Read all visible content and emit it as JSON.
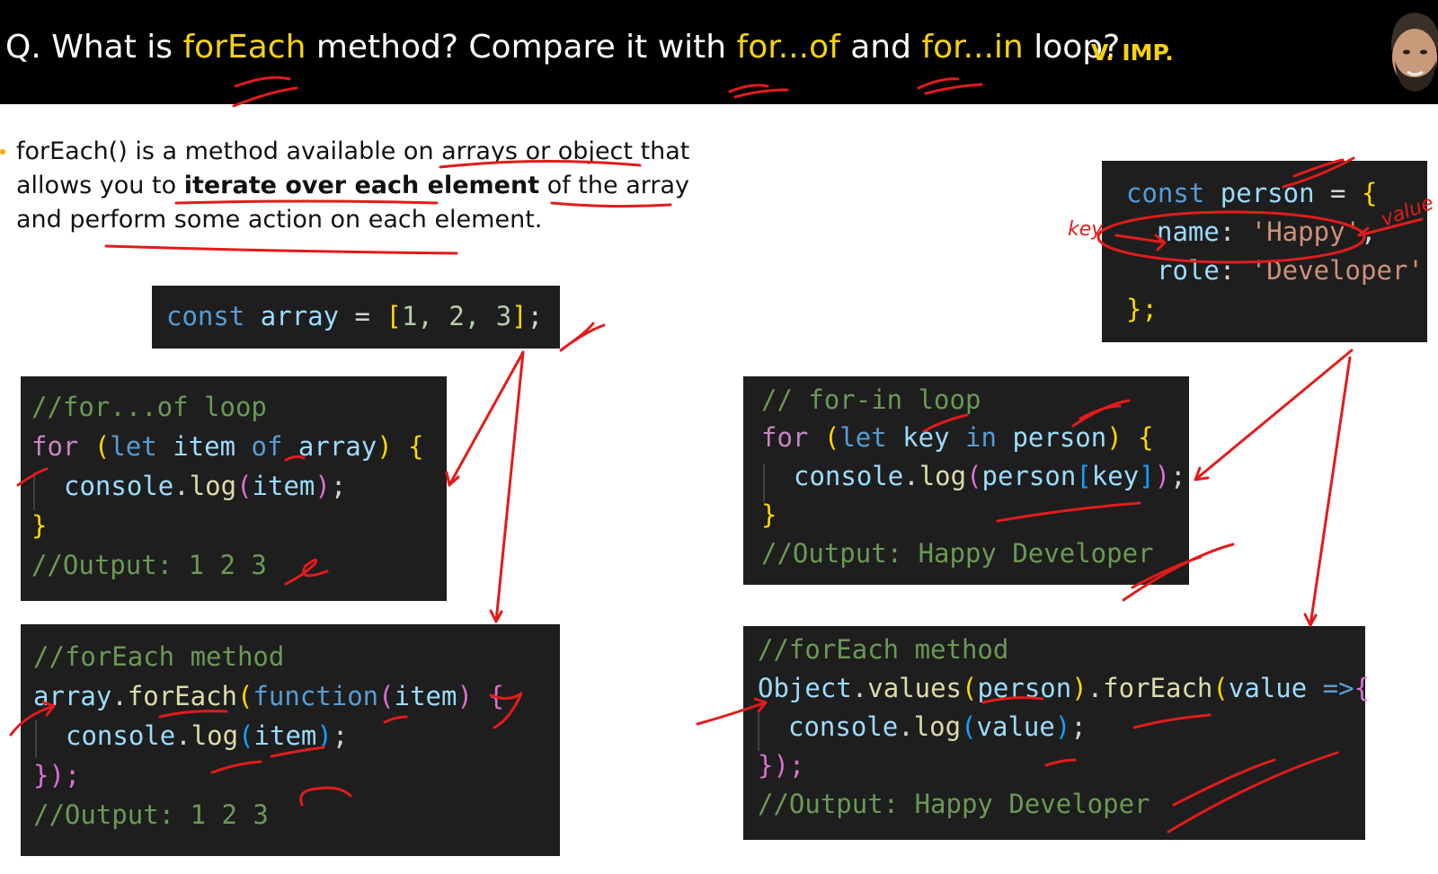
{
  "header": {
    "question_prefix": "Q. What is ",
    "kw_foreach": "forEach",
    "question_mid1": " method? Compare it with ",
    "kw_forof": "for...of",
    "question_mid2": " and ",
    "kw_forin": "for...in",
    "question_suffix": " loop?",
    "badge": "V. IMP."
  },
  "description": {
    "part1": "forEach() is a method available on arrays or object that allows you to ",
    "bold": "iterate over each element",
    "part2": " of the array and perform some action on each element."
  },
  "code": {
    "array_decl": {
      "const": "const",
      "name": "array",
      "eq": " = ",
      "open": "[",
      "values": "1, 2, 3",
      "close": "]",
      "semi": ";"
    },
    "person_decl": {
      "const": "const",
      "name": "person",
      "eq": " = ",
      "open": "{",
      "k1": "name",
      "v1": "'Happy'",
      "comma": ",",
      "k2": "role",
      "v2": "'Developer'",
      "close": "};"
    },
    "forof": {
      "comment": "//for...of loop",
      "for": "for",
      "let": "let",
      "item": "item",
      "of": "of",
      "array": "array",
      "console": "console",
      "log": "log",
      "arg": "item",
      "output": "//Output: 1 2 3"
    },
    "forin": {
      "comment": "// for-in loop",
      "for": "for",
      "let": "let",
      "key": "key",
      "in": "in",
      "person": "person",
      "console": "console",
      "log": "log",
      "obj": "person",
      "idx": "key",
      "output": "//Output: Happy Developer"
    },
    "foreach_arr": {
      "comment": "//forEach method",
      "array": "array",
      "method": "forEach",
      "function": "function",
      "param": "item",
      "console": "console",
      "log": "log",
      "arg": "item",
      "close": "});",
      "output": "//Output: 1 2 3"
    },
    "foreach_obj": {
      "comment": "//forEach method",
      "object": "Object",
      "values": "values",
      "person": "person",
      "method": "forEach",
      "param": "value",
      "arrow": "=>",
      "console": "console",
      "log": "log",
      "arg": "value",
      "close": "});",
      "output": "//Output: Happy Developer"
    }
  },
  "annotations": {
    "handwritten_key": "key",
    "handwritten_value": "value"
  }
}
